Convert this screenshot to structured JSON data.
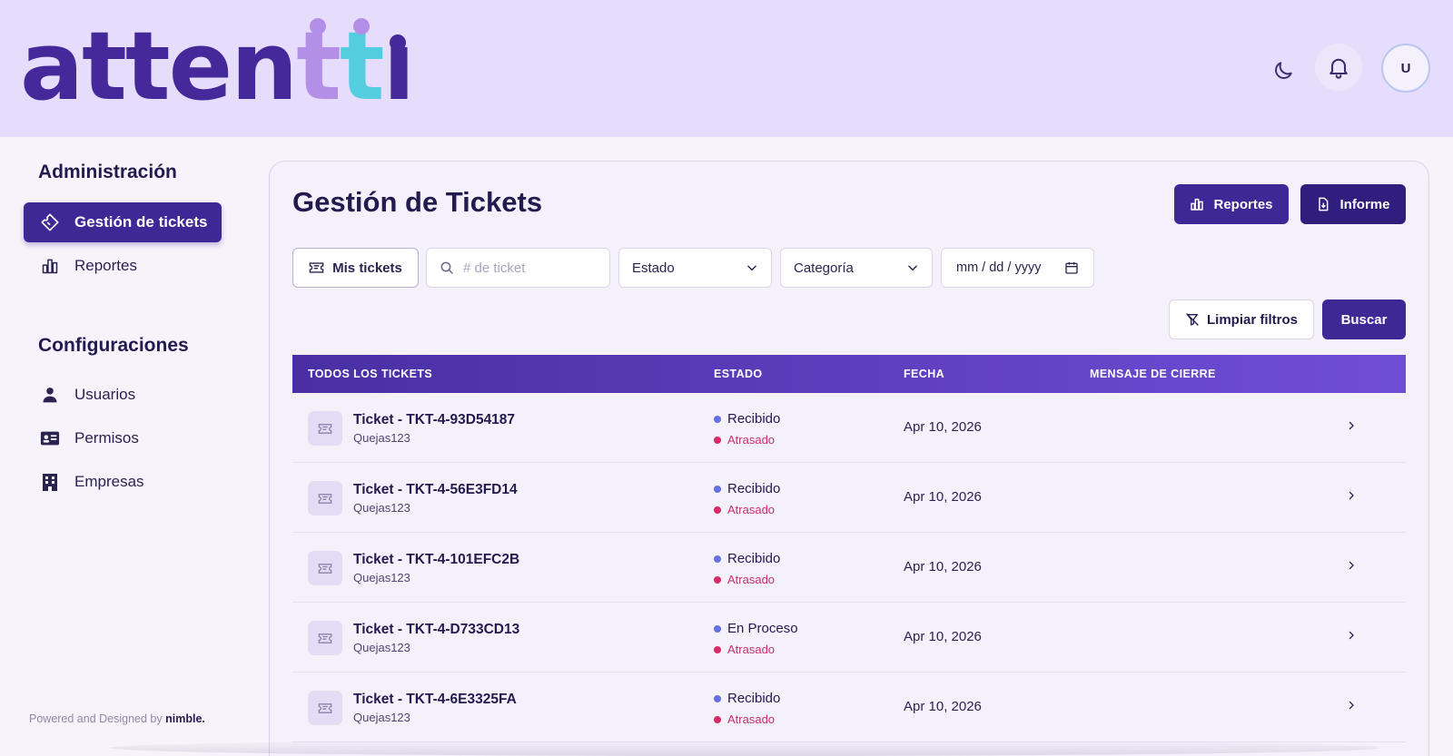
{
  "brand": {
    "logo_text": "attentti",
    "colors": {
      "primary": "#45289a",
      "accent_purple": "#b48fe8",
      "accent_cyan": "#55cde0",
      "header_bg": "#e6dcfb"
    }
  },
  "header": {
    "theme_icon": "moon-icon",
    "notifications_icon": "bell-icon",
    "avatar_initial": "U"
  },
  "sidebar": {
    "sections": [
      {
        "heading": "Administración",
        "items": [
          {
            "label": "Gestión de tickets",
            "icon": "ticket-icon",
            "active": true
          },
          {
            "label": "Reportes",
            "icon": "chart-icon",
            "active": false
          }
        ]
      },
      {
        "heading": "Configuraciones",
        "items": [
          {
            "label": "Usuarios",
            "icon": "user-icon"
          },
          {
            "label": "Permisos",
            "icon": "id-card-icon"
          },
          {
            "label": "Empresas",
            "icon": "building-icon"
          }
        ]
      }
    ],
    "footer": {
      "prefix": "Powered and Designed by",
      "brand": "nimble."
    }
  },
  "main": {
    "title": "Gestión de Tickets",
    "actions": {
      "reportes": "Reportes",
      "informe": "Informe"
    },
    "filters": {
      "mis_tickets": "Mis tickets",
      "search_placeholder": "# de ticket",
      "estado": "Estado",
      "categoria": "Categoría",
      "date_placeholder": "mm / dd / yyyy",
      "limpiar": "Limpiar filtros",
      "buscar": "Buscar"
    },
    "table": {
      "headers": [
        "TODOS LOS TICKETS",
        "ESTADO",
        "FECHA",
        "MENSAJE DE CIERRE"
      ],
      "rows": [
        {
          "name": "Ticket - TKT-4-93D54187",
          "category": "Quejas123",
          "status": "Recibido",
          "substatus": "Atrasado",
          "date": "Apr 10, 2026",
          "closing_message": ""
        },
        {
          "name": "Ticket - TKT-4-56E3FD14",
          "category": "Quejas123",
          "status": "Recibido",
          "substatus": "Atrasado",
          "date": "Apr 10, 2026",
          "closing_message": ""
        },
        {
          "name": "Ticket - TKT-4-101EFC2B",
          "category": "Quejas123",
          "status": "Recibido",
          "substatus": "Atrasado",
          "date": "Apr 10, 2026",
          "closing_message": ""
        },
        {
          "name": "Ticket - TKT-4-D733CD13",
          "category": "Quejas123",
          "status": "En Proceso",
          "substatus": "Atrasado",
          "date": "Apr 10, 2026",
          "closing_message": ""
        },
        {
          "name": "Ticket - TKT-4-6E3325FA",
          "category": "Quejas123",
          "status": "Recibido",
          "substatus": "Atrasado",
          "date": "Apr 10, 2026",
          "closing_message": ""
        }
      ]
    }
  }
}
